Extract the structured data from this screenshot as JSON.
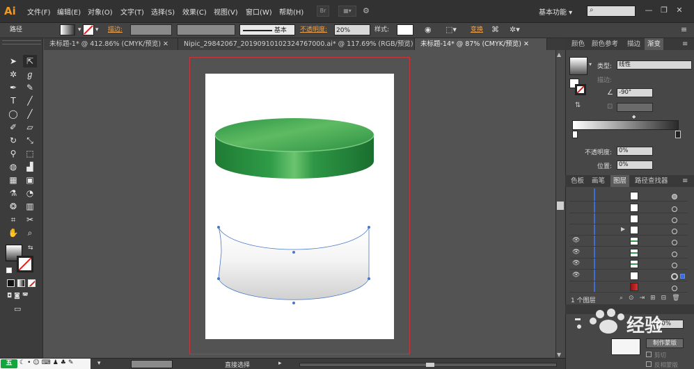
{
  "app": {
    "logo": "Ai",
    "menu": [
      "文件(F)",
      "编辑(E)",
      "对象(O)",
      "文字(T)",
      "选择(S)",
      "效果(C)",
      "视图(V)",
      "窗口(W)",
      "帮助(H)"
    ],
    "bridge_btn": "Br",
    "workspace": "基本功能",
    "window_controls": [
      "minimize-icon",
      "restore-icon",
      "close-icon"
    ]
  },
  "control_bar": {
    "object_type": "路径",
    "stroke_label": "描边:",
    "stroke_style": "基本",
    "opacity_label": "不透明度:",
    "opacity_value": "20%",
    "style_label": "样式:",
    "transform_label": "变换"
  },
  "tabs": [
    {
      "label": "未标题-1* @ 412.86% (CMYK/预览)",
      "active": false
    },
    {
      "label": "Nipic_29842067_20190910102324767000.ai* @ 117.69% (RGB/预览)",
      "active": false
    },
    {
      "label": "未标题-14* @ 87% (CMYK/预览)",
      "active": true
    }
  ],
  "tools": [
    "selection-tool-icon",
    "direct-selection-tool-icon",
    "magic-wand-icon",
    "lasso-icon",
    "pen-tool-icon",
    "curvature-icon",
    "type-tool-icon",
    "line-tool-icon",
    "ellipse-tool-icon",
    "paintbrush-icon",
    "pencil-icon",
    "eraser-icon",
    "rotate-icon",
    "scale-icon",
    "width-tool-icon",
    "free-transform-icon",
    "shape-builder-icon",
    "chart-icon",
    "mesh-icon",
    "gradient-tool-icon",
    "eyedropper-icon",
    "blend-icon",
    "symbol-sprayer-icon",
    "column-graph-icon",
    "artboard-icon",
    "slice-icon",
    "hand-icon",
    "zoom-icon"
  ],
  "panel_gradient": {
    "tabs": [
      "颜色",
      "颜色参考",
      "描边",
      "渐变"
    ],
    "active_tab": "渐变",
    "type_label": "类型:",
    "type_value": "线性",
    "stroke_label": "描边:",
    "angle_value": "-90°",
    "opacity_label": "不透明度:",
    "opacity_value": "0%",
    "location_label": "位置:",
    "location_value": "0%"
  },
  "panel_layers": {
    "tabs": [
      "色板",
      "画笔",
      "图层",
      "路径查找器"
    ],
    "active_tab": "图层",
    "count_text": "1 个图层",
    "rows": [
      {
        "visible": false,
        "thumb": "white"
      },
      {
        "visible": false,
        "thumb": "white"
      },
      {
        "visible": false,
        "thumb": "white"
      },
      {
        "visible": false,
        "thumb": "white",
        "expand": true
      },
      {
        "visible": true,
        "thumb": "green"
      },
      {
        "visible": true,
        "thumb": "green"
      },
      {
        "visible": true,
        "thumb": "green"
      },
      {
        "visible": true,
        "thumb": "white",
        "target": true
      },
      {
        "visible": false,
        "thumb": "red"
      }
    ]
  },
  "transparency": {
    "opacity_value": "20%",
    "make_mask": "制作蒙版",
    "clip": "剪切",
    "invert_mask": "反相蒙版"
  },
  "status_bar": {
    "zoom": "87%",
    "tool": "直接选择"
  },
  "ime": {
    "logo": "五",
    "icons": [
      "moon-icon",
      "punctuation-icon",
      "smile-icon",
      "keyboard-icon",
      "user-icon",
      "shirt-icon",
      "wrench-icon"
    ]
  },
  "colors": {
    "accent": "#f29a1f",
    "lid_green": "#2e9a47",
    "bleed_red": "#c8353a",
    "path_blue": "#4a78c8"
  },
  "watermark": "经验"
}
